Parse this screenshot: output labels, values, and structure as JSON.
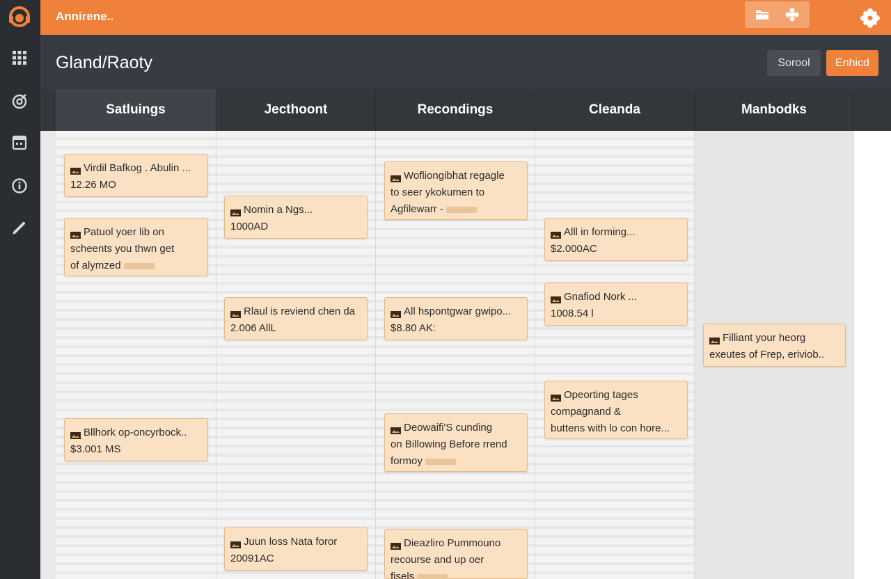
{
  "app": {
    "name": "Annirene.."
  },
  "header": {
    "title": "Gland/Raoty",
    "secondary_button": "Sorool",
    "primary_button": "Enhicd"
  },
  "columns": [
    {
      "title": "Satluings"
    },
    {
      "title": "Jecthoont"
    },
    {
      "title": "Recondings"
    },
    {
      "title": "Cleanda"
    },
    {
      "title": "Manbodks"
    }
  ],
  "cards": [
    {
      "lines": [
        "Virdil Bafkog . Abulin ...",
        "12.26 MO"
      ]
    },
    {
      "lines": [
        "Patuol yoer lib on",
        "scheents you thwn get",
        "of alymzed"
      ]
    },
    {
      "lines": [
        "Bllhork op-oncyrbock..",
        "$3.001 MS"
      ]
    },
    {
      "lines": [
        "Nomin a Ngs...",
        "1000AD"
      ]
    },
    {
      "lines": [
        "Rlaul is reviend chen da",
        "2.006 AllL"
      ]
    },
    {
      "lines": [
        "Juun loss Nata foror",
        "20091AC"
      ]
    },
    {
      "lines": [
        "Wofliongibhat regagle",
        "to seer ykokumen to",
        "Agfilewarr -"
      ]
    },
    {
      "lines": [
        "All hspontgwar gwipo...",
        "$8.80 AK:"
      ]
    },
    {
      "lines": [
        "Deowaifi'S cunding",
        "on Billowing Before rrend",
        "formoy"
      ]
    },
    {
      "lines": [
        "Dieazliro Pummouno",
        "recourse and up oer",
        "fisels"
      ]
    },
    {
      "lines": [
        "Alll in forming...",
        "$2.000AC"
      ]
    },
    {
      "lines": [
        "Gnafiod Nork ...",
        "1008.54 l"
      ]
    },
    {
      "lines": [
        "Opeorting tages",
        "compagnand &",
        "buttens with lo con hore..."
      ]
    },
    {
      "lines": [
        "Filliant your heorg",
        "exeutes of Frep, eriviob.."
      ]
    }
  ],
  "colors": {
    "accent": "#f0813a",
    "sidebar": "#2a2d31",
    "header": "#383c42",
    "card": "#fbe1c3"
  },
  "icons": [
    "headset-logo-icon",
    "grid-icon",
    "target-icon",
    "calendar-icon",
    "info-icon",
    "pen-icon",
    "folder-icon",
    "gear-icon",
    "flower-icon",
    "card-image-icon"
  ]
}
